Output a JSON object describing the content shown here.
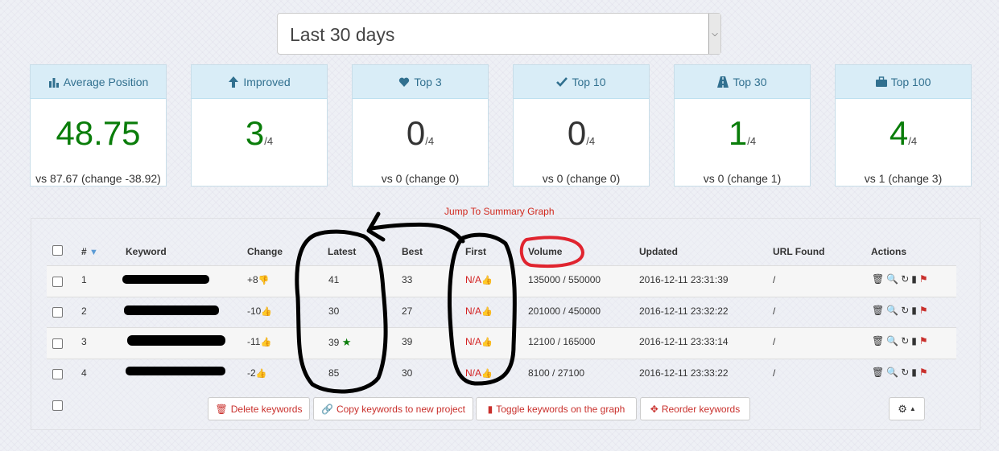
{
  "period_select": {
    "value": "Last 30 days"
  },
  "summary_cards": [
    {
      "title": "Average Position",
      "icon": "bar-chart-icon",
      "value": "48.75",
      "total": "",
      "comparison": "vs 87.67 (change -38.92)",
      "color": "#0a7d0a"
    },
    {
      "title": "Improved",
      "icon": "arrow-up-icon",
      "value": "3",
      "total": "/4",
      "comparison": "",
      "color": "#0a7d0a"
    },
    {
      "title": "Top 3",
      "icon": "heart-icon",
      "value": "0",
      "total": "/4",
      "comparison": "vs 0 (change 0)",
      "color": "#333333"
    },
    {
      "title": "Top 10",
      "icon": "check-icon",
      "value": "0",
      "total": "/4",
      "comparison": "vs 0 (change 0)",
      "color": "#333333"
    },
    {
      "title": "Top 30",
      "icon": "road-icon",
      "value": "1",
      "total": "/4",
      "comparison": "vs 0 (change 1)",
      "color": "#0a7d0a"
    },
    {
      "title": "Top 100",
      "icon": "briefcase-icon",
      "value": "4",
      "total": "/4",
      "comparison": "vs 1 (change 3)",
      "color": "#0a7d0a"
    }
  ],
  "jump_link": "Jump To Summary Graph",
  "table": {
    "headers": {
      "num": "#",
      "keyword": "Keyword",
      "change": "Change",
      "latest": "Latest",
      "best": "Best",
      "first": "First",
      "volume": "Volume",
      "updated": "Updated",
      "url": "URL Found",
      "actions": "Actions"
    },
    "rows": [
      {
        "num": "1",
        "change": "+8",
        "change_dir": "down",
        "latest": "41",
        "latest_star": false,
        "best": "33",
        "first": "N/A",
        "volume": "135000 / 550000",
        "updated": "2016-12-11 23:31:39",
        "url": "/"
      },
      {
        "num": "2",
        "change": "-10",
        "change_dir": "up",
        "latest": "30",
        "latest_star": false,
        "best": "27",
        "first": "N/A",
        "volume": "201000 / 450000",
        "updated": "2016-12-11 23:32:22",
        "url": "/"
      },
      {
        "num": "3",
        "change": "-11",
        "change_dir": "up",
        "latest": "39",
        "latest_star": true,
        "best": "39",
        "first": "N/A",
        "volume": "12100 / 165000",
        "updated": "2016-12-11 23:33:14",
        "url": "/"
      },
      {
        "num": "4",
        "change": "-2",
        "change_dir": "up",
        "latest": "85",
        "latest_star": false,
        "best": "30",
        "first": "N/A",
        "volume": "8100 / 27100",
        "updated": "2016-12-11 23:33:22",
        "url": "/"
      }
    ]
  },
  "buttons": {
    "delete": "Delete keywords",
    "copy": "Copy keywords to new project",
    "toggle": "Toggle keywords on the graph",
    "reorder": "Reorder keywords"
  },
  "colors": {
    "green": "#0a7d0a",
    "red": "#d31f1f",
    "info_bg": "#d9edf7",
    "info_text": "#31708f"
  }
}
